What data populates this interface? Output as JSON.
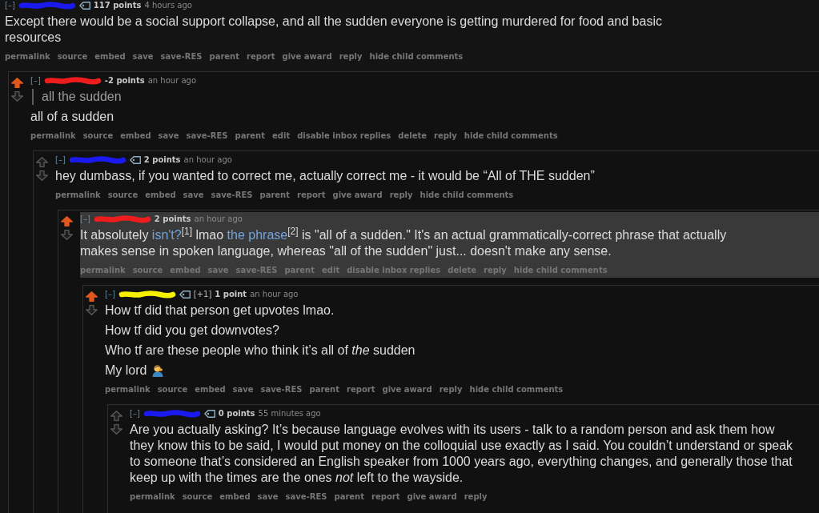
{
  "comments": [
    {
      "toggle": "[–]",
      "author_scribble": {
        "color": "#1a1aee"
      },
      "tag_button": true,
      "score": "117 points",
      "time": "4 hours ago",
      "highlighted": false,
      "body": [
        {
          "kind": "paragraph",
          "text": "Except there would be a social support collapse, and all the sudden everyone is getting murdered for food and basic resources"
        }
      ],
      "actions": [
        "permalink",
        "source",
        "embed",
        "save",
        "save-RES",
        "parent",
        "report",
        "give award",
        "reply",
        "hide child comments"
      ],
      "children": [
        {
          "upvoted": true,
          "downvoted": false,
          "toggle": "[–]",
          "author_scribble": {
            "color": "#ee1c1c"
          },
          "tag_button": false,
          "score": "-2 points",
          "time": "an hour ago",
          "highlighted": false,
          "body": [
            {
              "kind": "quote",
              "text": "all the sudden"
            },
            {
              "kind": "paragraph",
              "text": "all of a sudden"
            }
          ],
          "actions": [
            "permalink",
            "source",
            "embed",
            "save",
            "save-RES",
            "parent",
            "edit",
            "disable inbox replies",
            "delete",
            "reply",
            "hide child comments"
          ],
          "children": [
            {
              "upvoted": false,
              "downvoted": false,
              "toggle": "[–]",
              "author_scribble": {
                "color": "#1a1af0"
              },
              "tag_button": true,
              "score": "2 points",
              "time": "an hour ago",
              "highlighted": false,
              "body": [
                {
                  "kind": "paragraph",
                  "text": "hey dumbass, if you wanted to correct me, actually correct me - it would be “All of THE sudden”"
                }
              ],
              "actions": [
                "permalink",
                "source",
                "embed",
                "save",
                "save-RES",
                "parent",
                "report",
                "give award",
                "reply",
                "hide child comments"
              ],
              "children": [
                {
                  "upvoted": true,
                  "downvoted": false,
                  "toggle": "[–]",
                  "author_scribble": {
                    "color": "#ee1c1c"
                  },
                  "tag_button": false,
                  "score": "2 points",
                  "time": "an hour ago",
                  "highlighted": true,
                  "body": [
                    {
                      "kind": "linked_paragraph",
                      "parts": [
                        {
                          "kind": "text",
                          "text": "It absolutely "
                        },
                        {
                          "kind": "link",
                          "text": "isn't?"
                        },
                        {
                          "kind": "text",
                          "text": "$^{[1]}$ lmao "
                        },
                        {
                          "kind": "link",
                          "text": "the phrase"
                        },
                        {
                          "kind": "text",
                          "text": "$^{[2]}$ is \"all of a sudden.\" It's an actual grammatically-correct phrase that actually makes sense in spoken language, whereas \"all of the sudden\" just... doesn't make any sense."
                        }
                      ]
                    }
                  ],
                  "actions": [
                    "permalink",
                    "source",
                    "embed",
                    "save",
                    "save-RES",
                    "parent",
                    "edit",
                    "disable inbox replies",
                    "delete",
                    "reply",
                    "hide child comments"
                  ],
                  "children": [
                    {
                      "upvoted": true,
                      "downvoted": false,
                      "toggle": "[–]",
                      "author_scribble": {
                        "color": "#f5f000"
                      },
                      "tag_button": true,
                      "vote_weight": "[+1]",
                      "score": "1 point",
                      "time": "an hour ago",
                      "highlighted": false,
                      "body": [
                        {
                          "kind": "paragraph",
                          "text": "How tf did that person get upvotes lmao."
                        },
                        {
                          "kind": "paragraph",
                          "text": "How tf did you get downvotes?"
                        },
                        {
                          "kind": "paragraph",
                          "text": "Who tf are these people who think it’s all of *the* sudden"
                        },
                        {
                          "kind": "paragraph",
                          "text": "My lord",
                          "emoji": true
                        }
                      ],
                      "actions": [
                        "permalink",
                        "source",
                        "embed",
                        "save",
                        "save-RES",
                        "parent",
                        "report",
                        "give award",
                        "reply",
                        "hide child comments"
                      ],
                      "children": [
                        {
                          "upvoted": false,
                          "downvoted": false,
                          "toggle": "[–]",
                          "author_scribble": {
                            "color": "#1a1af0"
                          },
                          "tag_button": true,
                          "score": "0 points",
                          "time": "55 minutes ago",
                          "highlighted": false,
                          "body": [
                            {
                              "kind": "paragraph",
                              "text": "Are you actually asking? It’s because language evolves with its users - talk to a random person and ask them how they know this to be said, I would put money on the colloquial use exactly as I said. You couldn’t understand or speak to someone that’s considered an English speaker from 1000 years ago, everything changes, and generally those that keep up with the times are the ones *not* left to the wayside."
                            }
                          ],
                          "actions": [
                            "permalink",
                            "source",
                            "embed",
                            "save",
                            "save-RES",
                            "parent",
                            "report",
                            "give award",
                            "reply"
                          ]
                        }
                      ]
                    }
                  ]
                }
              ]
            }
          ]
        }
      ]
    }
  ]
}
